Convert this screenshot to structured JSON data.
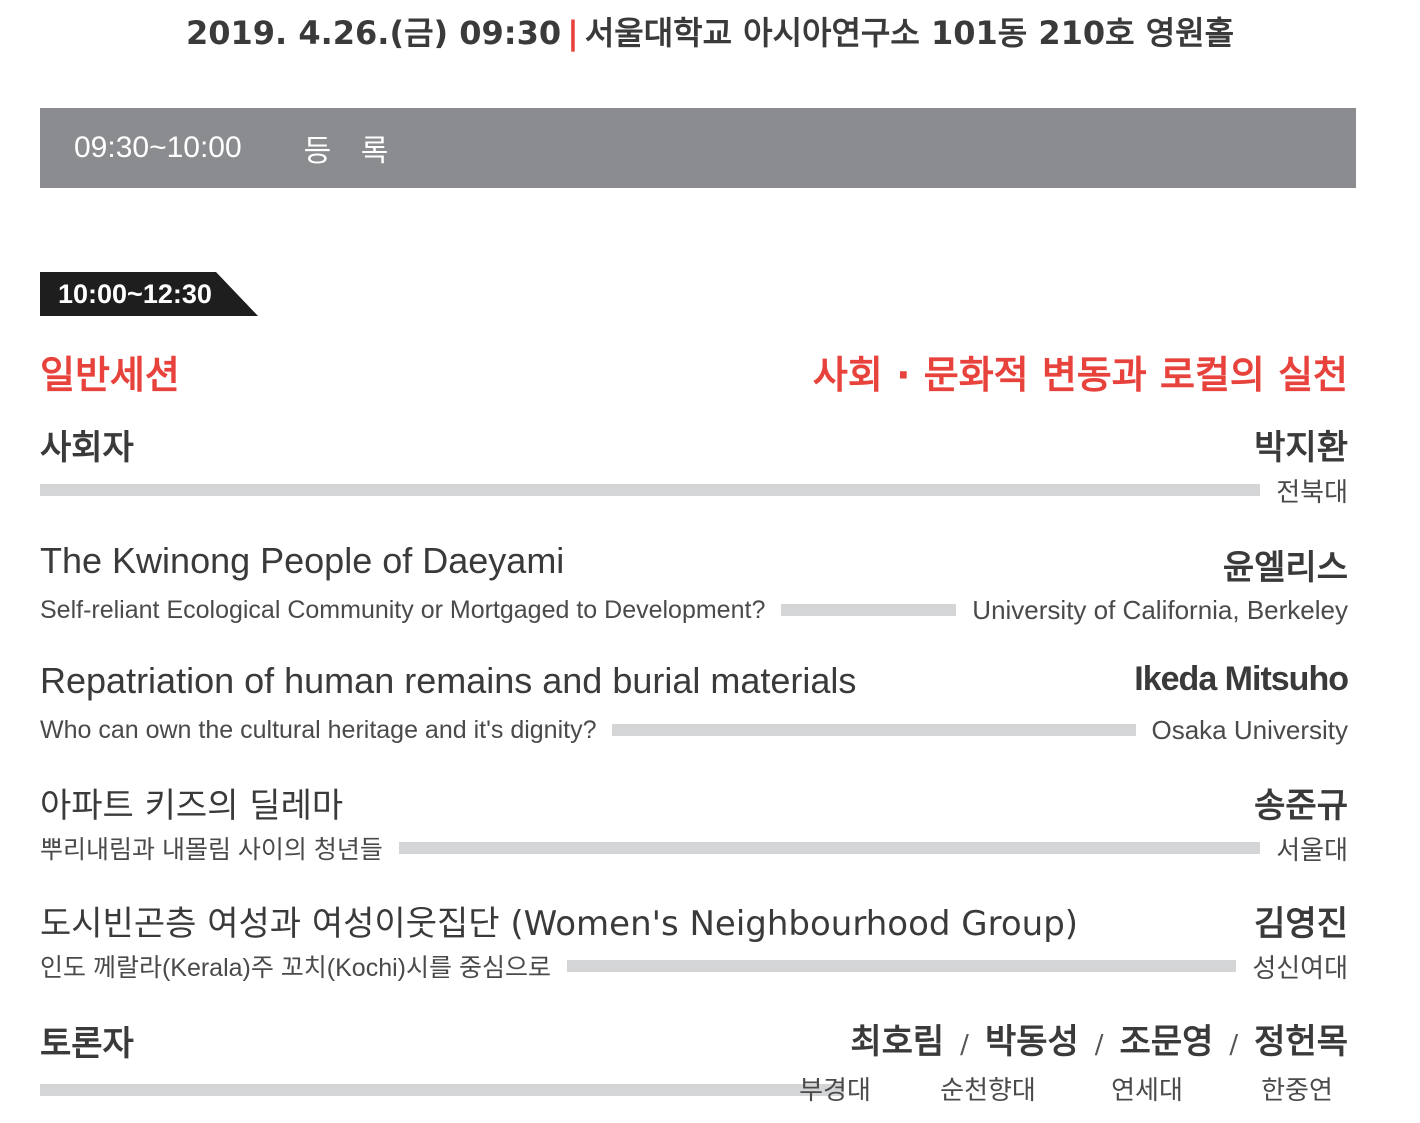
{
  "header": {
    "date": "2019. 4.26.(금) 09:30",
    "separator": "|",
    "venue": "서울대학교 아시아연구소 101동 210호 영원홀"
  },
  "registration": {
    "time": "09:30~10:00",
    "label": "등 록"
  },
  "session": {
    "time": "10:00~12:30",
    "name": "일반세션",
    "theme": "사회 · 문화적 변동과 로컬의 실천"
  },
  "moderator": {
    "label": "사회자",
    "name": "박지환",
    "affiliation": "전북대"
  },
  "talks": [
    {
      "title": "The Kwinong People of Daeyami",
      "subtitle": "Self-reliant Ecological Community or Mortgaged to Development?",
      "speaker": "윤엘리스",
      "affiliation": "University of California, Berkeley"
    },
    {
      "title": "Repatriation of human remains and burial materials",
      "subtitle": "Who can own the cultural heritage and it's dignity?",
      "speaker": "Ikeda Mitsuho",
      "affiliation": "Osaka University"
    },
    {
      "title": "아파트 키즈의 딜레마",
      "subtitle": "뿌리내림과 내몰림 사이의 청년들",
      "speaker": "송준규",
      "affiliation": "서울대"
    },
    {
      "title": "도시빈곤층 여성과 여성이웃집단 (Women's Neighbourhood Group)",
      "subtitle": "인도 께랄라(Kerala)주 꼬치(Kochi)시를 중심으로",
      "speaker": "김영진",
      "affiliation": "성신여대"
    }
  ],
  "discussants": {
    "label": "토론자",
    "separator": "/",
    "people": [
      {
        "name": "최호림",
        "affiliation": "부경대"
      },
      {
        "name": "박동성",
        "affiliation": "순천향대"
      },
      {
        "name": "조문영",
        "affiliation": "연세대"
      },
      {
        "name": "정헌목",
        "affiliation": "한중연"
      }
    ]
  }
}
